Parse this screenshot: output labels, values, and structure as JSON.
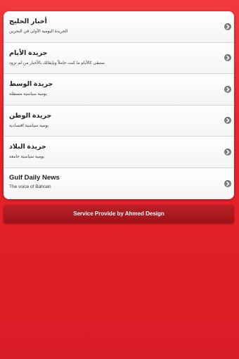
{
  "newspapers": [
    {
      "title": "أخبار الخليج",
      "subtitle": "الجريدة اليومية الأولى في البحرين"
    },
    {
      "title": "جريدة الأيام",
      "subtitle": "ستبقى كالأيام ما كنت حاملاً وبإبقائك بالأخبار من لم تزود"
    },
    {
      "title": "جريدة الوسط",
      "subtitle": "يومية سياسية مستقلة"
    },
    {
      "title": "جريدة الوطن",
      "subtitle": "يومية سياسية اقتصادية"
    },
    {
      "title": "جريدة البلاد",
      "subtitle": "يومية سياسية جامعة"
    },
    {
      "title": "Gulf Daily News",
      "subtitle": "The voice of Bahrain"
    }
  ],
  "footer": {
    "label": "Service Provide by Ahmed Design"
  },
  "icons": {
    "row_arrow": "chevron-right-icon"
  },
  "colors": {
    "background": "#e8232b",
    "footer": "#a8171c",
    "chevron": "#808080"
  }
}
